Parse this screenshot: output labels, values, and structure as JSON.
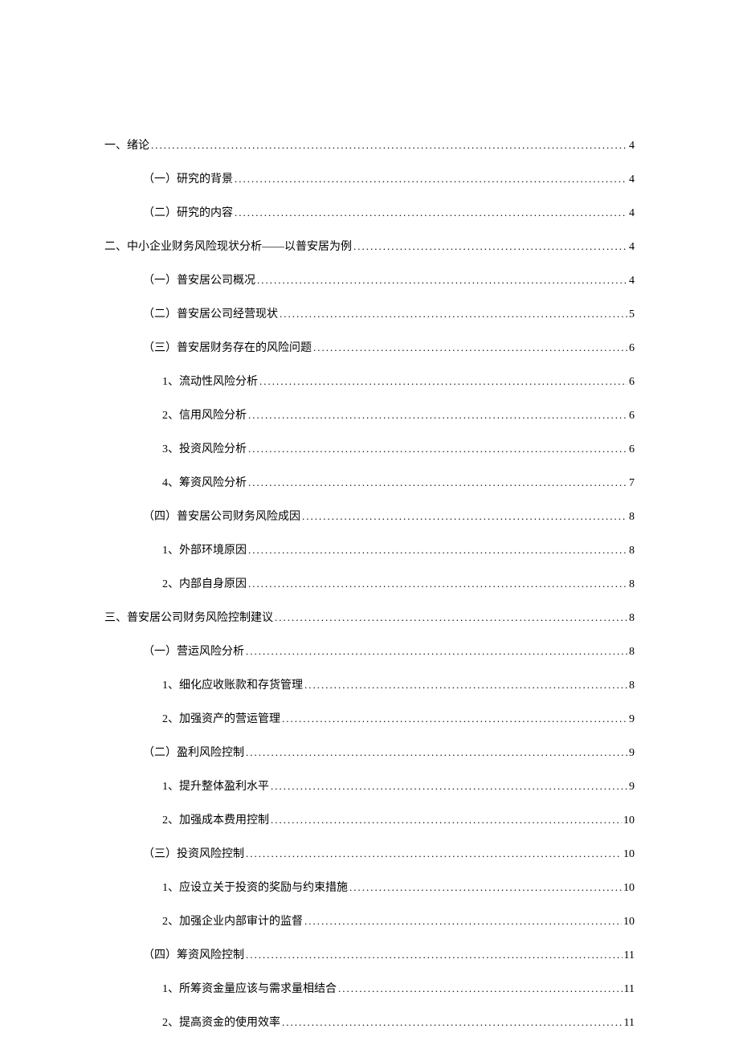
{
  "toc": [
    {
      "level": 1,
      "text": "一、绪论",
      "page": "4"
    },
    {
      "level": 2,
      "text": "（一）研究的背景",
      "page": "4"
    },
    {
      "level": 2,
      "text": "（二）研究的内容",
      "page": "4"
    },
    {
      "level": 1,
      "text": "二、中小企业财务风险现状分析——以普安居为例",
      "page": "4"
    },
    {
      "level": 2,
      "text": "（一）普安居公司概况",
      "page": "4"
    },
    {
      "level": 2,
      "text": "（二）普安居公司经营现状",
      "page": "5"
    },
    {
      "level": 2,
      "text": "（三）普安居财务存在的风险问题",
      "page": "6"
    },
    {
      "level": 3,
      "text": "1、流动性风险分析",
      "page": "6"
    },
    {
      "level": 3,
      "text": "2、信用风险分析",
      "page": "6"
    },
    {
      "level": 3,
      "text": "3、投资风险分析",
      "page": "6"
    },
    {
      "level": 3,
      "text": "4、筹资风险分析",
      "page": "7"
    },
    {
      "level": 2,
      "text": "（四）普安居公司财务风险成因",
      "page": "8"
    },
    {
      "level": 3,
      "text": "1、外部环境原因",
      "page": "8"
    },
    {
      "level": 3,
      "text": "2、内部自身原因",
      "page": "8"
    },
    {
      "level": 1,
      "text": "三、普安居公司财务风险控制建议",
      "page": "8"
    },
    {
      "level": 2,
      "text": "（一）营运风险分析",
      "page": "8"
    },
    {
      "level": 3,
      "text": "1、细化应收账款和存货管理",
      "page": "8"
    },
    {
      "level": 3,
      "text": "2、加强资产的营运管理",
      "page": "9"
    },
    {
      "level": 2,
      "text": "（二）盈利风险控制",
      "page": "9"
    },
    {
      "level": 3,
      "text": "1、提升整体盈利水平",
      "page": "9"
    },
    {
      "level": 3,
      "text": "2、加强成本费用控制",
      "page": "10"
    },
    {
      "level": 2,
      "text": "（三）投资风险控制",
      "page": "10"
    },
    {
      "level": 3,
      "text": "1、应设立关于投资的奖励与约束措施",
      "page": "10"
    },
    {
      "level": 3,
      "text": "2、加强企业内部审计的监督",
      "page": "10"
    },
    {
      "level": 2,
      "text": "（四）筹资风险控制",
      "page": "11"
    },
    {
      "level": 3,
      "text": "1、所筹资金量应该与需求量相结合",
      "page": "11"
    },
    {
      "level": 3,
      "text": "2、提高资金的使用效率",
      "page": "11"
    }
  ]
}
